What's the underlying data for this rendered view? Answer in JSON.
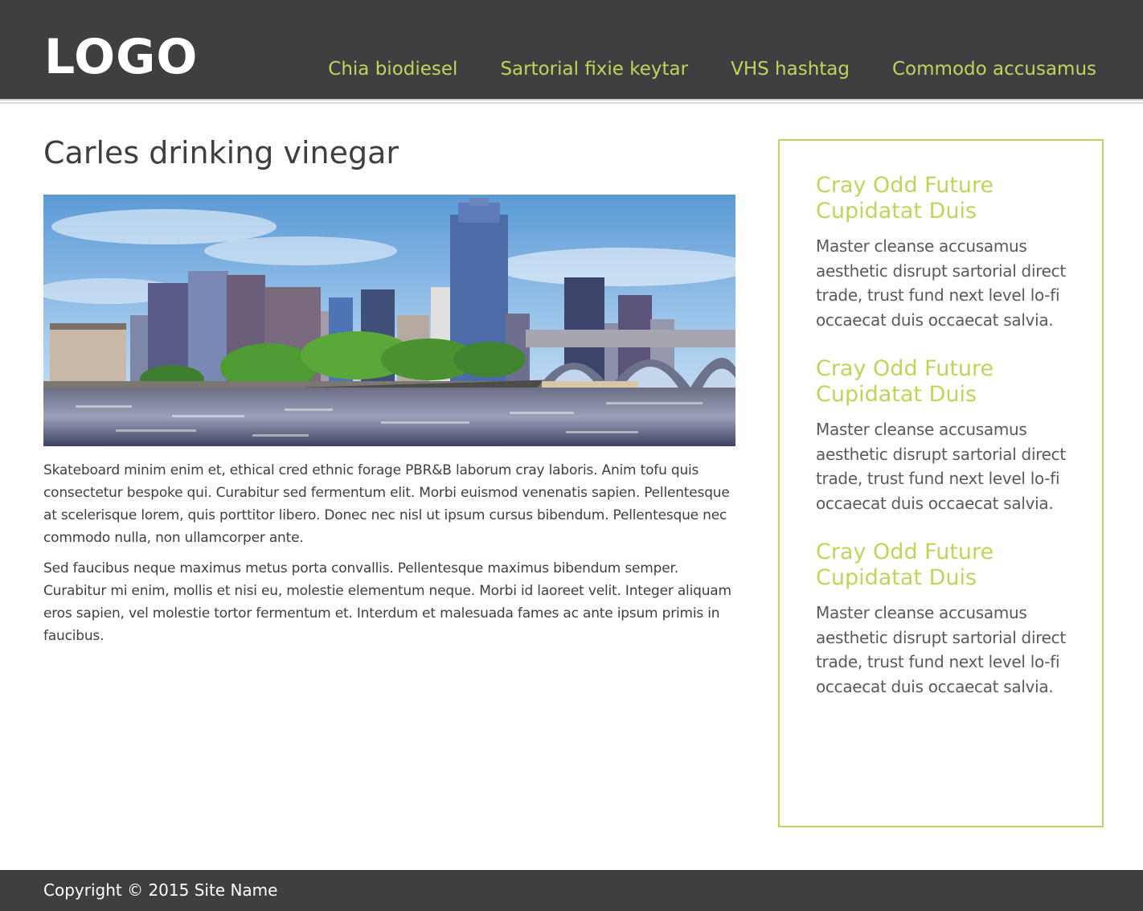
{
  "header": {
    "logo": "LOGO",
    "nav": [
      "Chia biodiesel",
      "Sartorial fixie keytar",
      "VHS hashtag",
      "Commodo accusamus"
    ]
  },
  "main": {
    "title": "Carles drinking vinegar",
    "paragraphs": [
      "Skateboard minim enim et, ethical cred ethnic forage PBR&B laborum cray laboris. Anim tofu quis consectetur bespoke qui. Curabitur sed fermentum elit. Morbi euismod venenatis sapien. Pellentesque at scelerisque lorem, quis porttitor libero. Donec nec nisl ut ipsum cursus bibendum. Pellentesque nec commodo nulla, non ullamcorper ante.",
      "Sed faucibus neque maximus metus porta convallis. Pellentesque maximus bibendum semper. Curabitur mi enim, mollis et nisi eu, molestie elementum neque. Morbi id laoreet velit. Integer aliquam eros sapien, vel molestie tortor fermentum et. Interdum et malesuada fames ac ante ipsum primis in faucibus."
    ]
  },
  "sidebar": {
    "blocks": [
      {
        "title": "Cray Odd Future Cupidatat Duis",
        "text": "Master cleanse accusamus aesthetic disrupt sartorial direct trade, trust fund next level lo-fi occaecat duis occaecat salvia."
      },
      {
        "title": "Cray Odd Future Cupidatat Duis",
        "text": "Master cleanse accusamus aesthetic disrupt sartorial direct trade, trust fund next level lo-fi occaecat duis occaecat salvia."
      },
      {
        "title": "Cray Odd Future Cupidatat Duis",
        "text": "Master cleanse accusamus aesthetic disrupt sartorial direct trade, trust fund next level lo-fi occaecat duis occaecat salvia."
      }
    ]
  },
  "footer": {
    "copyright": "Copyright © 2015 Site Name"
  },
  "colors": {
    "header_bg": "#3f3f41",
    "accent": "#c0d45a",
    "text": "#3f3f41"
  }
}
